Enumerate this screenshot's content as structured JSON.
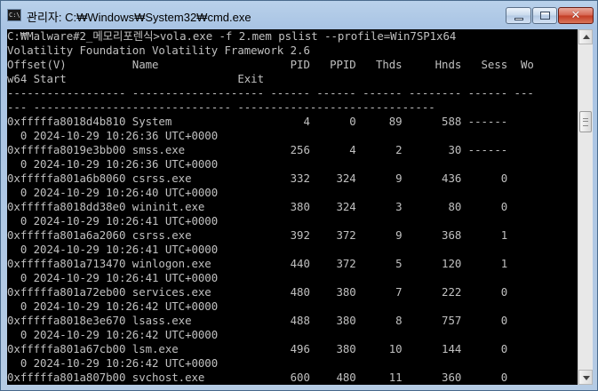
{
  "window": {
    "title": "관리자: C:₩Windows₩System32₩cmd.exe",
    "app_icon": "cmd-icon",
    "controls": {
      "minimize": "minimize-icon",
      "maximize": "maximize-icon",
      "close": "close-icon"
    }
  },
  "console": {
    "lines": [
      "C:₩Malware#2_메모리포렌식>vola.exe -f 2.mem pslist --profile=Win7SP1x64",
      "Volatility Foundation Volatility Framework 2.6",
      "Offset(V)          Name                    PID   PPID   Thds     Hnds   Sess  Wo",
      "w64 Start                          Exit",
      "------------------ -------------------- ------ ------ ------ -------- ------ ---",
      "--- ------------------------------ ------------------------------",
      "0xfffffa8018d4b810 System                    4      0     89      588 ------",
      "  0 2024-10-29 10:26:36 UTC+0000",
      "0xfffffa8019e3bb00 smss.exe                256      4      2       30 ------",
      "  0 2024-10-29 10:26:36 UTC+0000",
      "0xfffffa801a6b8060 csrss.exe               332    324      9      436      0",
      "  0 2024-10-29 10:26:40 UTC+0000",
      "0xfffffa8018dd38e0 wininit.exe             380    324      3       80      0",
      "  0 2024-10-29 10:26:41 UTC+0000",
      "0xfffffa801a6a2060 csrss.exe               392    372      9      368      1",
      "  0 2024-10-29 10:26:41 UTC+0000",
      "0xfffffa801a713470 winlogon.exe            440    372      5      120      1",
      "  0 2024-10-29 10:26:41 UTC+0000",
      "0xfffffa801a72eb00 services.exe            480    380      7      222      0",
      "  0 2024-10-29 10:26:42 UTC+0000",
      "0xfffffa8018e3e670 lsass.exe               488    380      8      757      0",
      "  0 2024-10-29 10:26:42 UTC+0000",
      "0xfffffa801a67cb00 lsm.exe                 496    380     10      144      0",
      "  0 2024-10-29 10:26:42 UTC+0000",
      "0xfffffa801a807b00 svchost.exe             600    480     11      360      0"
    ]
  },
  "scrollbar": {
    "up": "scroll-up-arrow-icon",
    "down": "scroll-down-arrow-icon"
  },
  "colors": {
    "console_bg": "#000000",
    "console_fg": "#c0c0c0",
    "close_red": "#c23a22"
  }
}
